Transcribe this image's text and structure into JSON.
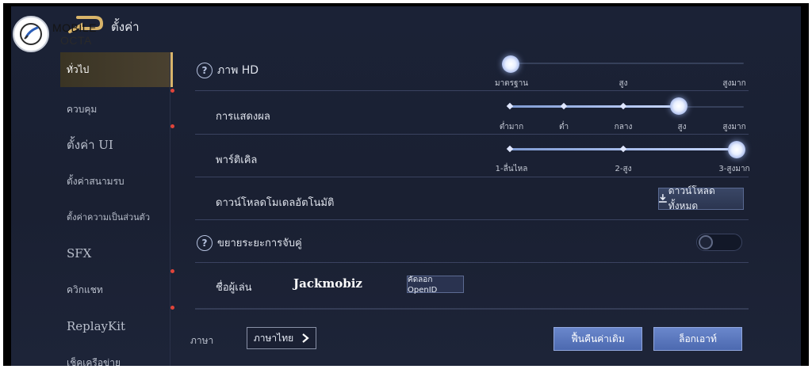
{
  "watermark": {
    "line1": "MOBILE",
    "line2": "OCTA"
  },
  "header": {
    "title": "ตั้งค่า"
  },
  "sidebar": {
    "items": [
      {
        "label": "ทั่วไป",
        "active": true,
        "dot": false
      },
      {
        "label": "ควบคุม",
        "active": false,
        "dot": true
      },
      {
        "label": "ตั้งค่า UI",
        "active": false,
        "dot": true
      },
      {
        "label": "ตั้งค่าสนามรบ",
        "active": false,
        "dot": false
      },
      {
        "label": "ตั้งค่าความเป็นส่วนตัว",
        "active": false,
        "dot": false
      },
      {
        "label": "SFX",
        "active": false,
        "dot": false
      },
      {
        "label": "ควิกแชท",
        "active": false,
        "dot": true
      },
      {
        "label": "ReplayKit",
        "active": false,
        "dot": true
      },
      {
        "label": "เช็คเครือข่าย",
        "active": false,
        "dot": false
      }
    ]
  },
  "settings": {
    "hd": {
      "label": "ภาพ HD",
      "ticks": [
        "มาตรฐาน",
        "สูง",
        "สูงมาก"
      ],
      "selected_index": 0
    },
    "display": {
      "label": "การแสดงผล",
      "ticks": [
        "ต่ำมาก",
        "ต่ำ",
        "กลาง",
        "สูง",
        "สูงมาก"
      ],
      "selected_index": 3
    },
    "particle": {
      "label": "พาร์ติเคิล",
      "ticks": [
        "1-ลื่นไหล",
        "2-สูง",
        "3-สูงมาก"
      ],
      "selected_index": 2
    },
    "auto_download": {
      "label": "ดาวน์โหลดโมเดลอัตโนมัติ",
      "button_label": "ดาวน์โหลดทั้งหมด"
    },
    "matchmaking": {
      "label": "ขยายระยะการจับคู่",
      "enabled": false
    },
    "player": {
      "label": "ชื่อผู้เล่น",
      "name": "Jackmobiz",
      "copy_label": "คัดลอก OpenID"
    }
  },
  "footer": {
    "language_label": "ภาษา",
    "language_value": "ภาษาไทย",
    "restore_label": "ฟื้นคืนค่าเดิม",
    "logout_label": "ล็อกเอาท์"
  },
  "colors": {
    "background": "#1b2236",
    "accent": "#d8b46a",
    "slider_fill": "#a9bff5",
    "button_primary": "#5a78be",
    "badge_dot": "#e0443a"
  }
}
